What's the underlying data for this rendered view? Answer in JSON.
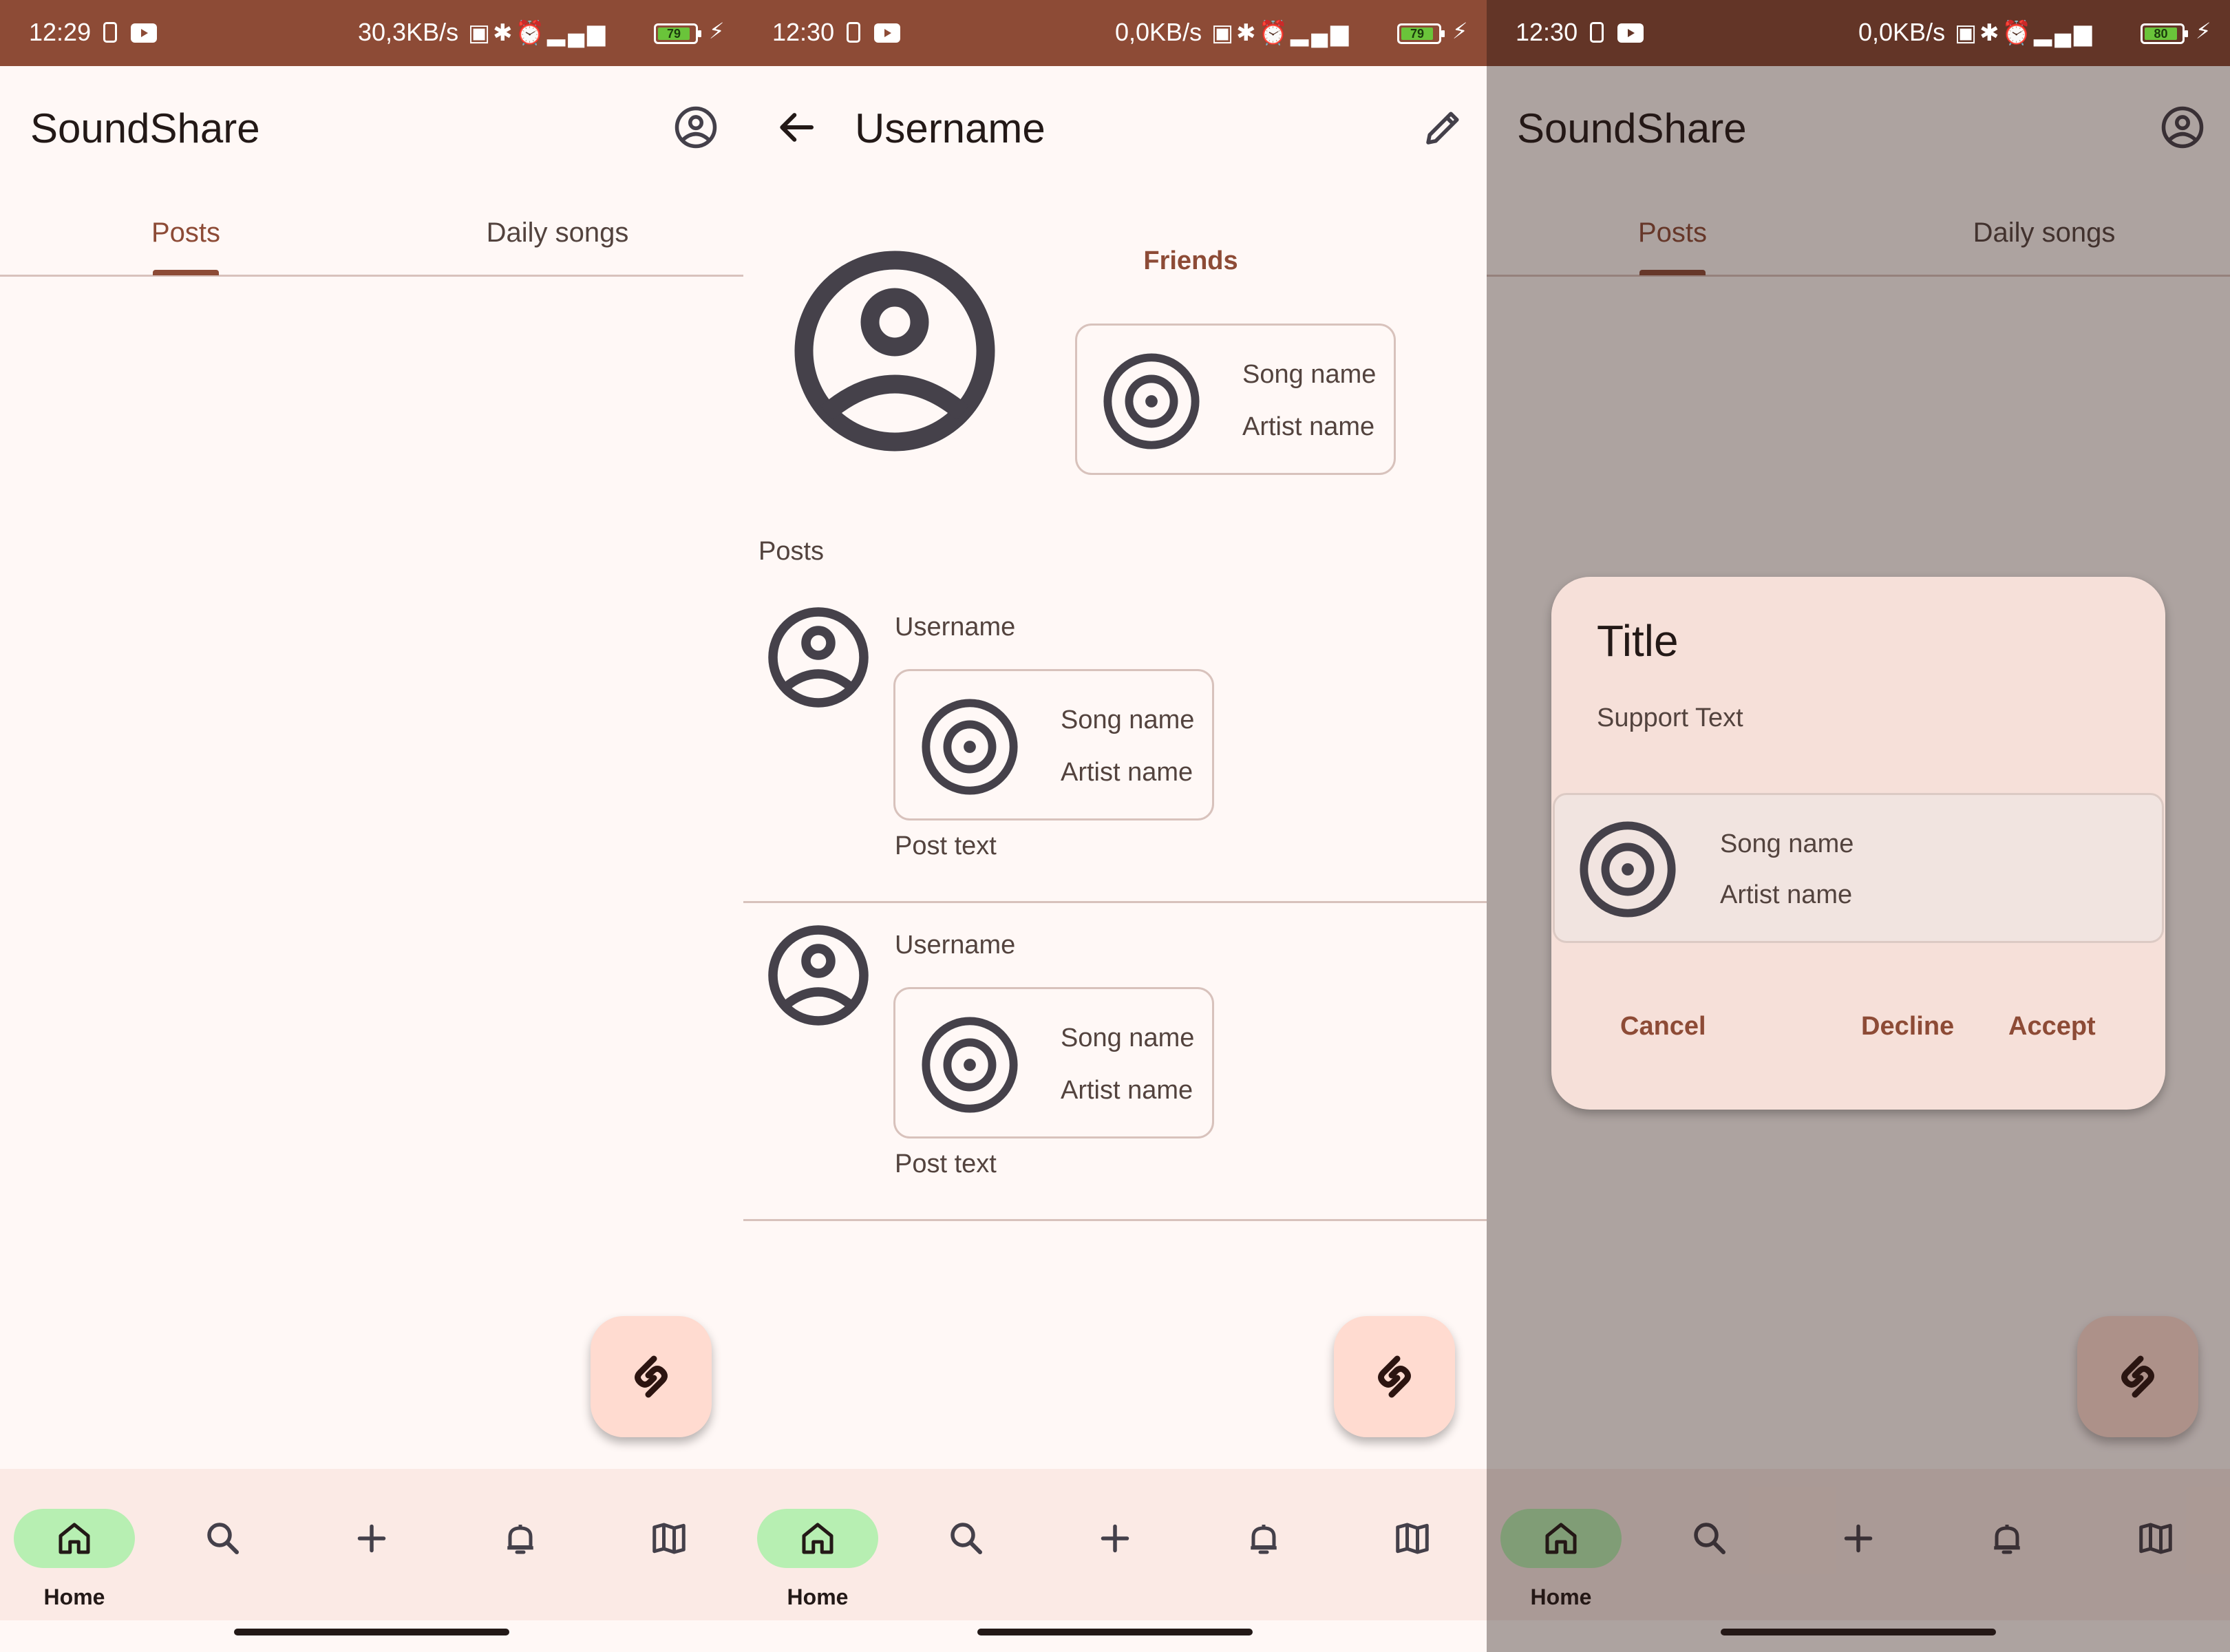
{
  "colors": {
    "primary": "#8d4b36",
    "surface": "#fff8f6",
    "nav_bar": "#fbeae5",
    "nav_active_pill": "#b7efb2",
    "fab": "#ffdbd0",
    "dialog": "#f6e0d9",
    "on_surface": "#231917",
    "on_surface_variant": "#53433e"
  },
  "screens": [
    {
      "status": {
        "time": "12:29",
        "speed": "30,3KB/s",
        "battery": "79"
      },
      "app_title": "SoundShare",
      "tabs": [
        {
          "label": "Posts",
          "active": true
        },
        {
          "label": "Daily songs",
          "active": false
        }
      ],
      "account_icon": "account-circle-icon",
      "fab_icon": "shazam-icon",
      "nav": [
        {
          "label": "Home",
          "icon": "home-icon",
          "active": true
        },
        {
          "label": "",
          "icon": "search-icon"
        },
        {
          "label": "",
          "icon": "add-icon"
        },
        {
          "label": "",
          "icon": "bell-icon"
        },
        {
          "label": "",
          "icon": "map-icon"
        }
      ]
    },
    {
      "status": {
        "time": "12:30",
        "speed": "0,0KB/s",
        "battery": "79"
      },
      "title": "Username",
      "back_icon": "arrow-back-icon",
      "edit_icon": "edit-icon",
      "friends_label": "Friends",
      "friend_song": {
        "song": "Song name",
        "artist": "Artist name"
      },
      "posts_label": "Posts",
      "posts": [
        {
          "username": "Username",
          "song": "Song name",
          "artist": "Artist name",
          "text": "Post text"
        },
        {
          "username": "Username",
          "song": "Song name",
          "artist": "Artist name",
          "text": "Post text"
        }
      ],
      "nav_home_label": "Home"
    },
    {
      "status": {
        "time": "12:30",
        "speed": "0,0KB/s",
        "battery": "80"
      },
      "app_title": "SoundShare",
      "tabs": [
        {
          "label": "Posts",
          "active": true
        },
        {
          "label": "Daily songs",
          "active": false
        }
      ],
      "dialog": {
        "title": "Title",
        "support_text": "Support Text",
        "song": "Song name",
        "artist": "Artist name",
        "cancel": "Cancel",
        "decline": "Decline",
        "accept": "Accept"
      },
      "nav_home_label": "Home"
    }
  ]
}
